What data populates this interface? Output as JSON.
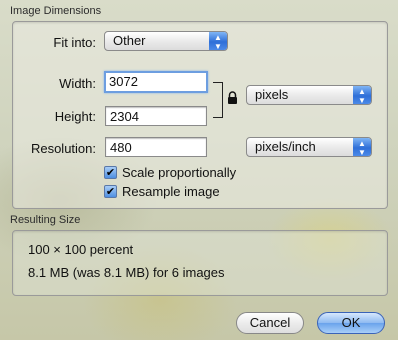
{
  "image_dimensions": {
    "title": "Image Dimensions",
    "fit_into": {
      "label": "Fit into:",
      "value": "Other"
    },
    "width": {
      "label": "Width:",
      "value": "3072"
    },
    "height": {
      "label": "Height:",
      "value": "2304"
    },
    "size_unit": {
      "value": "pixels"
    },
    "resolution": {
      "label": "Resolution:",
      "value": "480"
    },
    "resolution_unit": {
      "value": "pixels/inch"
    },
    "scale_proportionally": {
      "label": "Scale proportionally",
      "checked": true
    },
    "resample_image": {
      "label": "Resample image",
      "checked": true
    }
  },
  "resulting_size": {
    "title": "Resulting Size",
    "percent_line": "100 × 100 percent",
    "size_line": "8.1 MB (was 8.1 MB) for 6 images"
  },
  "buttons": {
    "cancel": "Cancel",
    "ok": "OK"
  },
  "icons": {
    "lock": "lock-icon",
    "popup_arrows": "up-down-arrows-icon",
    "checkmark": "checkmark-icon"
  },
  "colors": {
    "accent_blue": "#2f6fd8",
    "focus_ring": "#6d9ee0"
  }
}
